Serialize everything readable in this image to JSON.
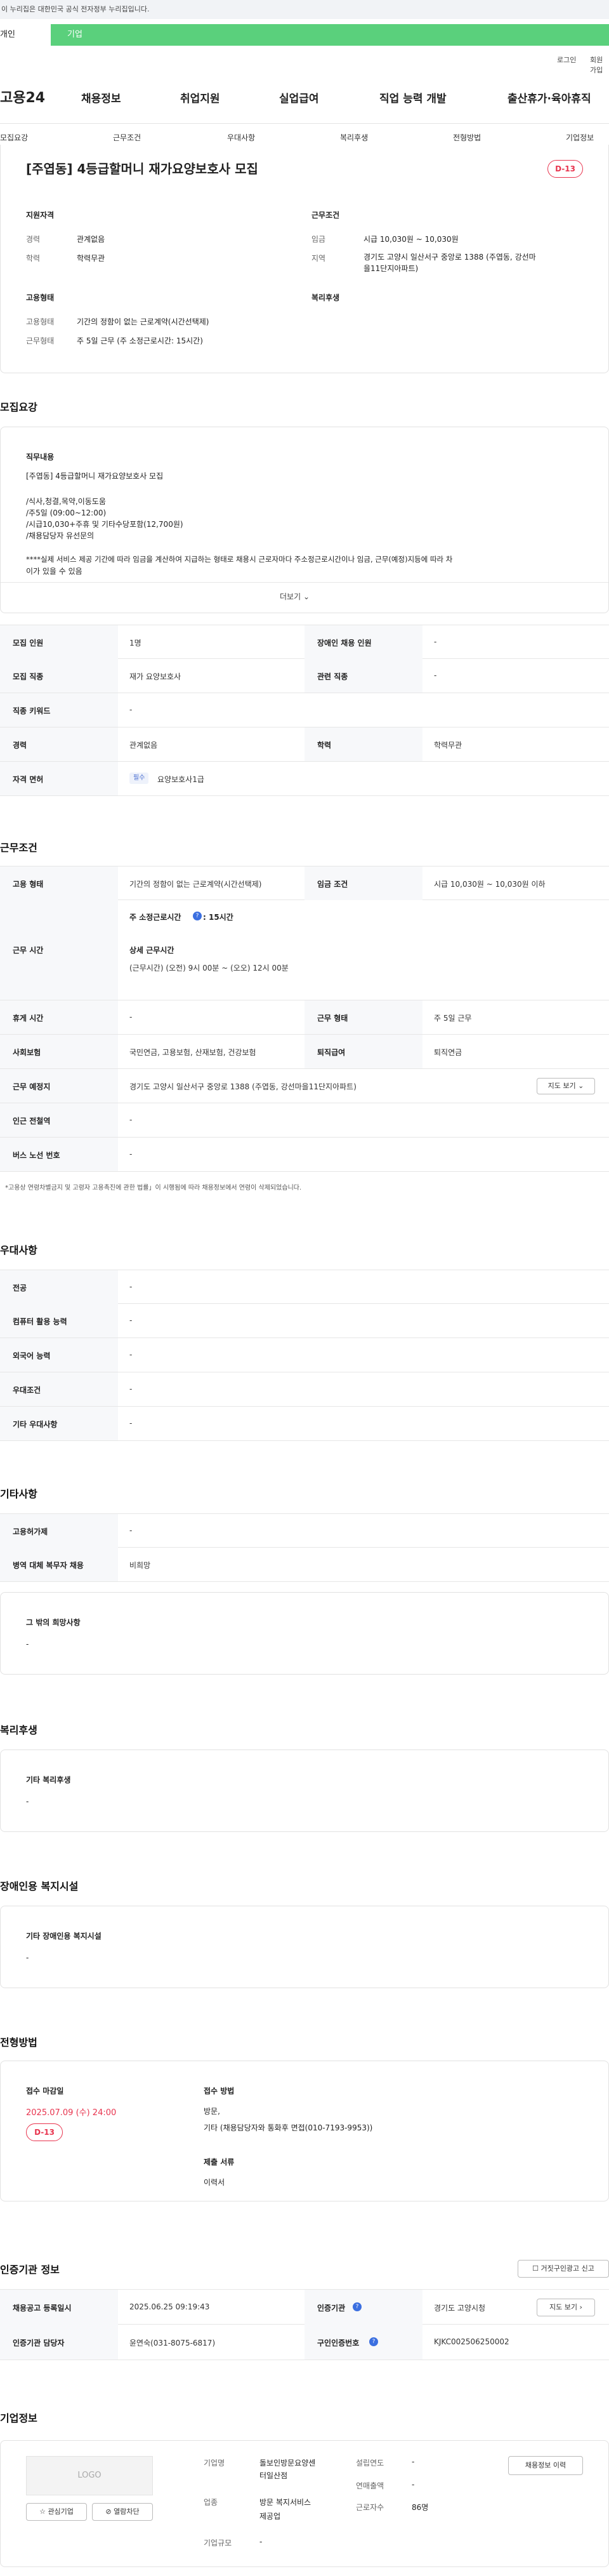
{
  "gov_banner": "이 누리집은 대한민국 공식 전자정부 누리집입니다.",
  "member_tabs": {
    "personal": "개인",
    "company": "기업"
  },
  "util": {
    "login": "로그인",
    "signup": "회원가입"
  },
  "logo": "고용24",
  "gnb": [
    "채용정보",
    "취업지원",
    "실업급여",
    "직업 능력 개발",
    "출산휴가·육아휴직"
  ],
  "anchors": [
    "모집요강",
    "근무조건",
    "우대사항",
    "복리후생",
    "전형방법",
    "기업정보"
  ],
  "header_card": {
    "title": "[주엽동] 4등급할머니 재가요양보호사 모집",
    "dday": "D-13",
    "qual_title": "지원자격",
    "qual": [
      {
        "k": "경력",
        "v": "관계없음"
      },
      {
        "k": "학력",
        "v": "학력무관"
      }
    ],
    "cond_title": "근무조건",
    "cond": [
      {
        "k": "임금",
        "v": "시급 10,030원 ~ 10,030원"
      },
      {
        "k": "지역",
        "v": "경기도 고양시 일산서구 중앙로 1388 (주엽동, 강선마"
      },
      {
        "k": "",
        "v": "을11단지아파트)"
      }
    ],
    "emp_title": "고용형태",
    "emp": [
      {
        "k": "고용형태",
        "v": "기간의 정함이 없는 근로계약(시간선택제)"
      },
      {
        "k": "근무형태",
        "v": "주 5일 근무 (주 소정근로시간: 15시간)"
      }
    ],
    "welfare_title": "복리후생"
  },
  "recruit": {
    "heading": "모집요강",
    "job_title": "직무내용",
    "job_lines": [
      "[주엽동] 4등급할머니 재가요양보호사 모집",
      "",
      "/식사,청결,목약,이동도움",
      "/주5일 (09:00~12:00)",
      "/시급10,030+주휴 및 기타수당포함(12,700원)",
      "/채용담당자 유선문의",
      "",
      "****실제 서비스 제공 기간에 따라 임금을 계산하여 지급하는 형태로 채용시 근로자마다 주소정근로시간이나 임금, 근무(예정)지등에 따라 차",
      "이가 있을 수 있음"
    ],
    "more": "더보기",
    "rows": [
      {
        "th1": "모집 인원",
        "td1": "1명",
        "th2": "장애인 채용 인원",
        "td2": "-"
      },
      {
        "th1": "모집 직종",
        "td1": "재가 요양보호사",
        "th2": "관련 직종",
        "td2": "-"
      },
      {
        "th1": "직종 키워드",
        "td1": "-"
      },
      {
        "th1": "경력",
        "td1": "관계없음",
        "th2": "학력",
        "td2": "학력무관"
      }
    ],
    "license_th": "자격 면허",
    "license_tag": "필수",
    "license_v": "요양보호사1급"
  },
  "work": {
    "heading": "근무조건",
    "emp_th": "고용 형태",
    "emp_v": "기간의 정함이 없는 근로계약(시간선택제)",
    "wage_th": "임금 조건",
    "wage_v": "시급 10,030원 ~ 10,030원 이하",
    "time_th": "근무 시간",
    "time_weekly_label": "주 소정근로시간",
    "time_weekly_v": ": 15시간",
    "time_detail_label": "상세 근무시간",
    "time_detail_v": "(근무시간) (오전) 9시 00분 ~ (오오) 12시 00분",
    "rest_th": "휴게 시간",
    "rest_v": "-",
    "form_th": "근무 형태",
    "form_v": "주 5일 근무",
    "ins_th": "사회보험",
    "ins_v": "국민연금, 고용보험, 산재보험, 건강보험",
    "ret_th": "퇴직급여",
    "ret_v": "퇴직연금",
    "place_th": "근무 예정지",
    "place_v": "경기도 고양시 일산서구 중앙로 1388 (주엽동, 강선마을11단지아파트)",
    "map_btn": "지도 보기",
    "sub_th": "인근 전철역",
    "sub_v": "-",
    "bus_th": "버스 노선 번호",
    "bus_v": "-",
    "note": "*고용상 연령차별금지 및 고령자 고용촉진에 관한 법률」이 시행됨에 따라 채용정보에서 연령이 삭제되었습니다."
  },
  "prefer": {
    "heading": "우대사항",
    "rows": [
      {
        "th": "전공",
        "td": "-"
      },
      {
        "th": "컴퓨터 활용 능력",
        "td": "-"
      },
      {
        "th": "외국어 능력",
        "td": "-"
      },
      {
        "th": "우대조건",
        "td": "-"
      },
      {
        "th": "기타 우대사항",
        "td": "-"
      }
    ]
  },
  "etc": {
    "heading": "기타사항",
    "rows": [
      {
        "th": "고용허가제",
        "td": "-"
      },
      {
        "th": "병역 대체 복무자 채용",
        "td": "비희망"
      }
    ],
    "hope_title": "그 밖의 희망사항",
    "hope_v": "-"
  },
  "welfare": {
    "heading": "복리후생",
    "title": "기타 복리후생",
    "v": "-"
  },
  "disabled": {
    "heading": "장애인용 복지시설",
    "title": "기타 장애인용 복지시설",
    "v": "-"
  },
  "screening": {
    "heading": "전형방법",
    "deadline_title": "접수 마감일",
    "deadline": "2025.07.09 (수) 24:00",
    "dday": "D-13",
    "method_title": "접수 방법",
    "method_lines": [
      "방문,",
      "기타 (채용담당자와 통화후 면접(010-7193-9953))"
    ],
    "docs_title": "제출 서류",
    "docs": "이력서"
  },
  "agency": {
    "heading": "인증기관 정보",
    "report_btn": "거짓구인광고 신고",
    "rows": [
      {
        "th1": "채용공고 등록일시",
        "td1": "2025.06.25 09:19:43",
        "th2": "인증기관",
        "td2": "경기도 고양시청",
        "btn": "지도 보기"
      },
      {
        "th1": "인증기관 담당자",
        "td1": "윤연숙(031-8075-6817)",
        "th2": "구인인증번호",
        "td2": "KJKC002506250002"
      }
    ]
  },
  "company": {
    "heading": "기업정보",
    "logo": "LOGO",
    "fav_btn": "관심기업",
    "block_btn": "열람차단",
    "name_k": "기업명",
    "name_v1": "돌보인방문요양센",
    "name_v2": "터일산점",
    "industry_k": "업종",
    "industry_v1": "방문 복지서비스",
    "industry_v2": "제공업",
    "scale_k": "기업규모",
    "scale_v": "-",
    "est_k": "설립연도",
    "est_v": "-",
    "sales_k": "연매출액",
    "sales_v": "-",
    "staff_k": "근로자수",
    "staff_v": "86명",
    "recruit_btn": "채용정보 이력"
  }
}
